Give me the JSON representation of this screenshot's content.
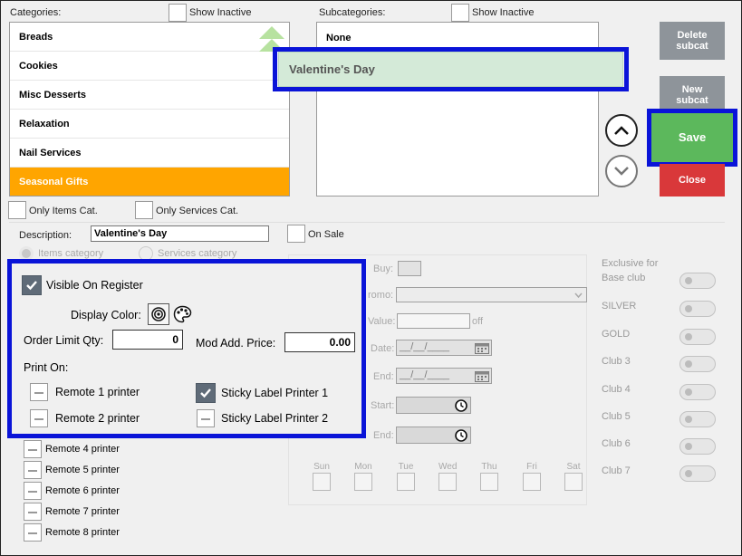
{
  "categories": {
    "label": "Categories:",
    "show_inactive": "Show Inactive",
    "items": [
      {
        "label": "Breads"
      },
      {
        "label": "Cookies"
      },
      {
        "label": "Misc Desserts"
      },
      {
        "label": "Relaxation"
      },
      {
        "label": "Nail Services"
      },
      {
        "label": "Seasonal Gifts",
        "selected": true
      }
    ],
    "only_items": "Only Items Cat.",
    "only_services": "Only Services Cat."
  },
  "subcategories": {
    "label": "Subcategories:",
    "show_inactive": "Show Inactive",
    "items": [
      {
        "label": "None"
      }
    ],
    "popup_value": "Valentine's Day"
  },
  "buttons": {
    "delete_subcat": "Delete subcat",
    "new_subcat": "New subcat",
    "save": "Save",
    "close": "Close"
  },
  "description": {
    "label": "Description:",
    "value": "Valentine's Day",
    "on_sale": "On Sale",
    "items_category": "Items category",
    "services_category": "Services category"
  },
  "register": {
    "visible_label": "Visible On Register",
    "display_color_label": "Display Color:",
    "order_limit_label": "Order Limit Qty:",
    "order_limit_value": "0",
    "mod_price_label": "Mod Add. Price:",
    "mod_price_value": "0.00",
    "print_on_label": "Print On:"
  },
  "printers": {
    "remote1": "Remote 1 printer",
    "remote2": "Remote 2 printer",
    "sticky1": "Sticky Label Printer 1",
    "sticky2": "Sticky Label Printer 2",
    "remote4": "Remote 4 printer",
    "remote5": "Remote 5 printer",
    "remote6": "Remote 6 printer",
    "remote7": "Remote 7 printer",
    "remote8": "Remote 8 printer"
  },
  "sale": {
    "buy": "Buy:",
    "promo": "romo:",
    "value": "Value:",
    "off": "off",
    "date": "Date:",
    "date_placeholder": "__/__/____",
    "end": "End:",
    "end_placeholder": "__/__/____",
    "start_time": "Start:",
    "end_time": "End:",
    "days": [
      "Sun",
      "Mon",
      "Tue",
      "Wed",
      "Thu",
      "Fri",
      "Sat"
    ]
  },
  "clubs": {
    "exclusive_label": "Exclusive for",
    "items": [
      "Base club",
      "SILVER",
      "GOLD",
      "Club 3",
      "Club 4",
      "Club 5",
      "Club 6",
      "Club 7"
    ]
  },
  "colors": {
    "selected": "#ffa500",
    "save": "#5cb85c",
    "close": "#d9383a",
    "gray_button": "#8e949a",
    "highlight": "#0a14d8",
    "popup": "#d4ead8"
  }
}
